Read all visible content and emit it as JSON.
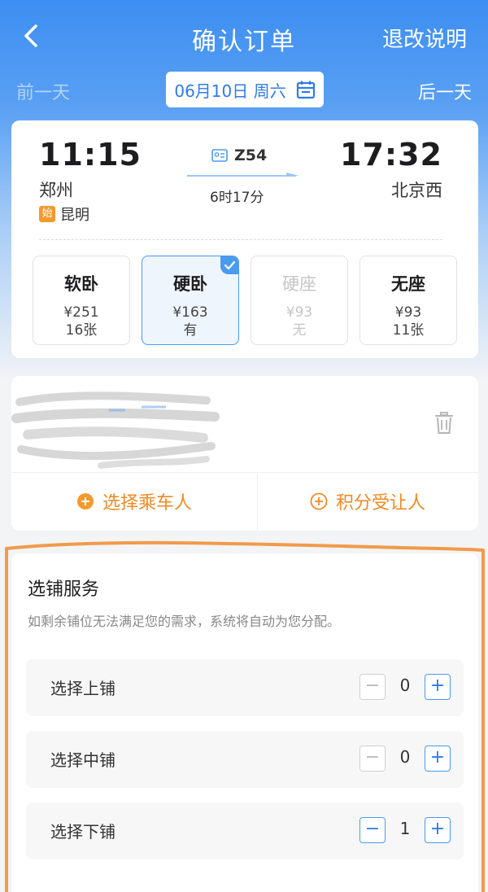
{
  "header": {
    "title": "确认订单",
    "refund_link": "退改说明"
  },
  "date_bar": {
    "prev_label": "前一天",
    "date_label": "06月10日 周六",
    "next_label": "后一天"
  },
  "train": {
    "departure_time": "11:15",
    "departure_station": "郑州",
    "origin_badge": "始",
    "origin_station": "昆明",
    "train_number": "Z54",
    "duration": "6时17分",
    "arrival_time": "17:32",
    "arrival_station": "北京西"
  },
  "seats": [
    {
      "name": "软卧",
      "price": "¥251",
      "availability": "16张",
      "state": "normal"
    },
    {
      "name": "硬卧",
      "price": "¥163",
      "availability": "有",
      "state": "selected"
    },
    {
      "name": "硬座",
      "price": "¥93",
      "availability": "无",
      "state": "disabled"
    },
    {
      "name": "无座",
      "price": "¥93",
      "availability": "11张",
      "state": "normal"
    }
  ],
  "passenger": {
    "select_passenger": "选择乘车人",
    "points_transfer": "积分受让人"
  },
  "berth_service": {
    "title": "选铺服务",
    "hint": "如剩余铺位无法满足您的需求，系统将自动为您分配。",
    "rows": [
      {
        "label": "选择上铺",
        "value": "0"
      },
      {
        "label": "选择中铺",
        "value": "0"
      },
      {
        "label": "选择下铺",
        "value": "1"
      }
    ],
    "minus_symbol": "−",
    "plus_symbol": "+"
  },
  "colors": {
    "primary_blue": "#3c8ef2",
    "accent_orange": "#f08a24",
    "annotation_orange": "#f29a4a"
  },
  "icons": [
    "back-chevron-icon",
    "calendar-icon",
    "id-card-icon",
    "arrow-line-icon",
    "trash-icon",
    "plus-circle-icon"
  ]
}
